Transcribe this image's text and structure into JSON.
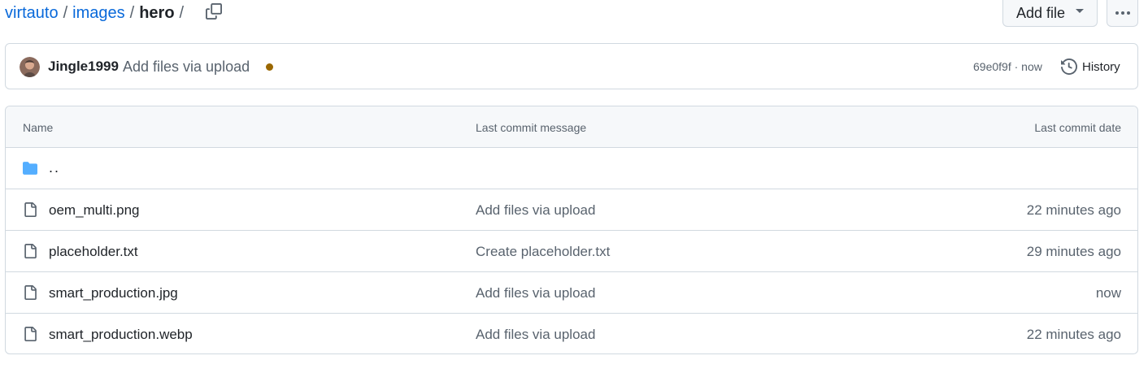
{
  "breadcrumb": {
    "repo": "virtauto",
    "folder": "images",
    "current": "hero",
    "separator": "/"
  },
  "actions": {
    "add_file_label": "Add file",
    "more_icon": "kebab-horizontal-icon",
    "copy_icon": "copy-icon"
  },
  "commit": {
    "author": "Jingle1999",
    "message": "Add files via upload",
    "status_color": "#9a6700",
    "sha": "69e0f9f",
    "time_sep": " · ",
    "time": "now",
    "history_label": "History"
  },
  "table": {
    "headers": {
      "name": "Name",
      "message": "Last commit message",
      "date": "Last commit date"
    },
    "parent_label": "..",
    "rows": [
      {
        "name": "oem_multi.png",
        "message": "Add files via upload",
        "date": "22 minutes ago"
      },
      {
        "name": "placeholder.txt",
        "message": "Create placeholder.txt",
        "date": "29 minutes ago"
      },
      {
        "name": "smart_production.jpg",
        "message": "Add files via upload",
        "date": "now"
      },
      {
        "name": "smart_production.webp",
        "message": "Add files via upload",
        "date": "22 minutes ago"
      }
    ]
  },
  "colors": {
    "link": "#0969da",
    "folder": "#54aeff",
    "muted": "#59636e",
    "border": "#d1d9e0"
  }
}
